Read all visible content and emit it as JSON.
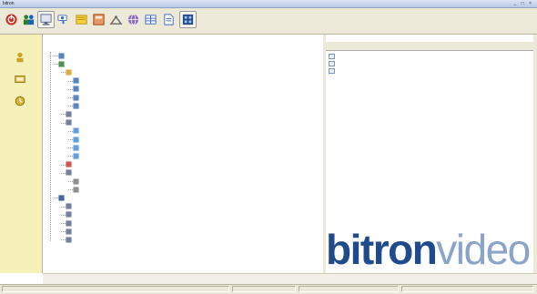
{
  "window": {
    "title": "bitron",
    "controls": "_ □ ×"
  },
  "toolbar": {
    "buttons": [
      {
        "name": "exit",
        "label": "",
        "icon": "power-icon",
        "color": "#c0392b"
      },
      {
        "name": "users",
        "label": "",
        "icon": "users-icon",
        "color": "#2e7d32"
      },
      {
        "name": "monitor",
        "label": "",
        "icon": "monitor-icon",
        "color": "#5b6b8c"
      },
      {
        "name": "camera",
        "label": "",
        "icon": "camera-icon",
        "color": "#3d6fb6"
      },
      {
        "name": "folder",
        "label": "",
        "icon": "folder-icon",
        "color": "#d4a017"
      },
      {
        "name": "book",
        "label": "",
        "icon": "book-icon",
        "color": "#c47f17"
      },
      {
        "name": "tools",
        "label": "",
        "icon": "tools-icon",
        "color": "#6a6a6a"
      },
      {
        "name": "globe",
        "label": "",
        "icon": "globe-icon",
        "color": "#6b3fa0"
      },
      {
        "name": "grid",
        "label": "",
        "icon": "grid-icon",
        "color": "#3d6fb6"
      },
      {
        "name": "document",
        "label": "",
        "icon": "document-icon",
        "color": "#3d6fb6"
      },
      {
        "name": "config",
        "label": "",
        "icon": "config-icon",
        "color": "#1f4b8c"
      }
    ]
  },
  "leftrail": {
    "items": [
      {
        "name": "users",
        "icon": "group-icon",
        "label": ""
      },
      {
        "name": "devices",
        "icon": "device-icon",
        "label": ""
      },
      {
        "name": "events",
        "icon": "event-icon",
        "label": ""
      }
    ],
    "bottom_label": ""
  },
  "tree": {
    "header": "",
    "nodes": [
      {
        "depth": 2,
        "icon": "pc-icon",
        "label": ""
      },
      {
        "depth": 2,
        "icon": "network-icon",
        "label": ""
      },
      {
        "depth": 3,
        "icon": "folder-icon",
        "label": ""
      },
      {
        "depth": 4,
        "icon": "camera-icon",
        "label": ""
      },
      {
        "depth": 4,
        "icon": "camera-icon",
        "label": ""
      },
      {
        "depth": 4,
        "icon": "camera-icon",
        "label": ""
      },
      {
        "depth": 4,
        "icon": "camera-icon",
        "label": ""
      },
      {
        "depth": 3,
        "icon": "device-icon",
        "label": ""
      },
      {
        "depth": 3,
        "icon": "device-icon",
        "label": ""
      },
      {
        "depth": 4,
        "icon": "monitor-icon",
        "label": ""
      },
      {
        "depth": 4,
        "icon": "monitor-icon",
        "label": ""
      },
      {
        "depth": 4,
        "icon": "monitor-icon",
        "label": ""
      },
      {
        "depth": 4,
        "icon": "monitor-icon",
        "label": ""
      },
      {
        "depth": 3,
        "icon": "alarm-icon",
        "label": ""
      },
      {
        "depth": 3,
        "icon": "device-icon",
        "label": ""
      },
      {
        "depth": 4,
        "icon": "relay-icon",
        "label": ""
      },
      {
        "depth": 4,
        "icon": "relay-icon",
        "label": ""
      },
      {
        "depth": 2,
        "icon": "map-icon",
        "label": ""
      },
      {
        "depth": 3,
        "icon": "device-icon",
        "label": ""
      },
      {
        "depth": 3,
        "icon": "device-icon",
        "label": ""
      },
      {
        "depth": 3,
        "icon": "device-icon",
        "label": ""
      },
      {
        "depth": 3,
        "icon": "device-icon",
        "label": ""
      },
      {
        "depth": 3,
        "icon": "device-icon",
        "label": ""
      }
    ]
  },
  "rightpane": {
    "columns": [
      "",
      ""
    ],
    "items": [
      {
        "icon": "list-icon",
        "label": ""
      },
      {
        "icon": "list-icon",
        "label": ""
      },
      {
        "icon": "list-icon",
        "label": ""
      }
    ]
  },
  "logo": {
    "part1": "bitron",
    "part2": "video"
  },
  "statusbar": {
    "panels": [
      "",
      "",
      "",
      ""
    ]
  },
  "colors": {
    "logo_primary": "#1f4b8c",
    "logo_secondary": "#8aa3c9",
    "rail_bg": "#f5f0b8",
    "chrome": "#ece9d8"
  }
}
